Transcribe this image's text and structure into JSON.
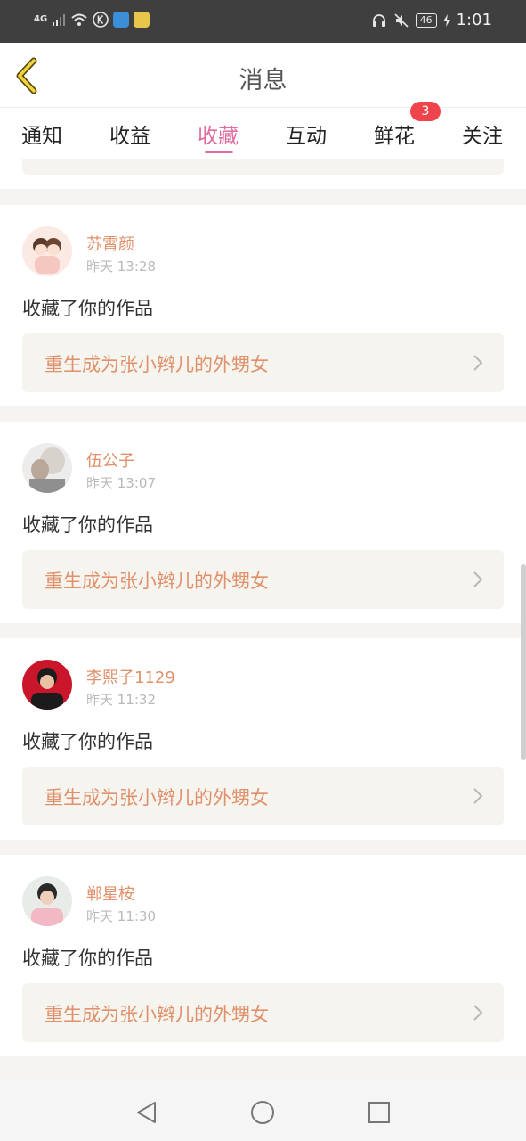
{
  "status_bar": {
    "signal_text": "4G",
    "battery": "46",
    "time": "1:01"
  },
  "header": {
    "title": "消息",
    "back_icon": "chevron-left-icon"
  },
  "tabs": [
    {
      "label": "通知",
      "active": false
    },
    {
      "label": "收益",
      "active": false
    },
    {
      "label": "收藏",
      "active": true
    },
    {
      "label": "互动",
      "active": false
    },
    {
      "label": "鲜花",
      "active": false,
      "badge": "3"
    },
    {
      "label": "关注",
      "active": false
    }
  ],
  "cards": [
    {
      "user": "苏霄颜",
      "time": "昨天 13:28",
      "action": "收藏了你的作品",
      "book": "重生成为张小辫儿的外甥女"
    },
    {
      "user": "伍公子",
      "time": "昨天 13:07",
      "action": "收藏了你的作品",
      "book": "重生成为张小辫儿的外甥女"
    },
    {
      "user": "李熙子1129",
      "time": "昨天 11:32",
      "action": "收藏了你的作品",
      "book": "重生成为张小辫儿的外甥女"
    },
    {
      "user": "郸星桉",
      "time": "昨天 11:30",
      "action": "收藏了你的作品",
      "book": "重生成为张小辫儿的外甥女"
    }
  ],
  "colors": {
    "accent_pink": "#e06c9f",
    "name_orange": "#e0906a",
    "badge_red": "#f0444c",
    "book_bg": "#f5f4ee"
  },
  "system_nav": [
    "back-triangle-icon",
    "home-circle-icon",
    "recents-square-icon"
  ]
}
